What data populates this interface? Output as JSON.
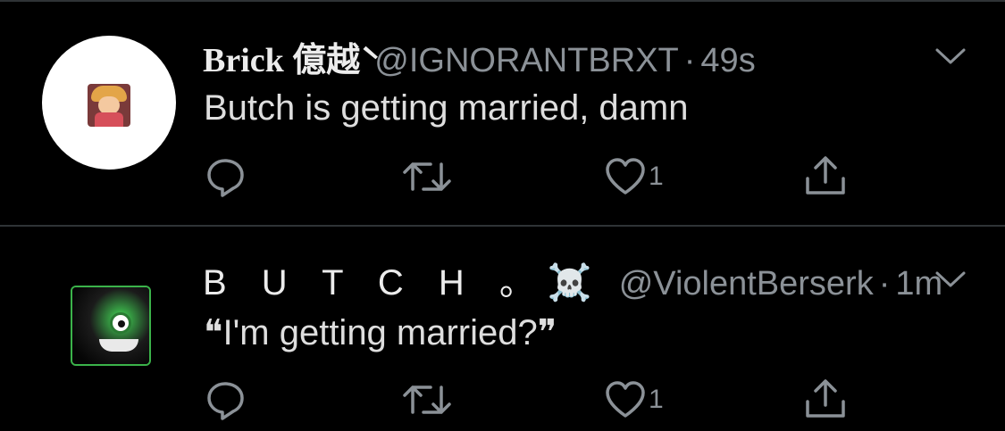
{
  "tweets": [
    {
      "display_name": "Brick 億越̀",
      "handle": "@IGNORANTBRXT",
      "separator": "·",
      "time": "49s",
      "text": "Butch is getting married, damn",
      "like_count": "1",
      "icons": {
        "reply": "reply-icon",
        "retweet": "retweet-icon",
        "like": "heart-icon",
        "share": "share-icon",
        "more": "chevron-down-icon"
      }
    },
    {
      "display_name": "B U T C H 。☠️",
      "handle": "@ViolentBerserk",
      "separator": "·",
      "time": "1m",
      "text": "❝I'm getting married?❞",
      "like_count": "1",
      "icons": {
        "reply": "reply-icon",
        "retweet": "retweet-icon",
        "like": "heart-icon",
        "share": "share-icon",
        "more": "chevron-down-icon"
      }
    }
  ],
  "colors": {
    "background": "#000000",
    "text": "#d9d9d9",
    "secondary": "#8b9197",
    "divider": "#2f3336",
    "avatar_border": "#3bb34a"
  }
}
